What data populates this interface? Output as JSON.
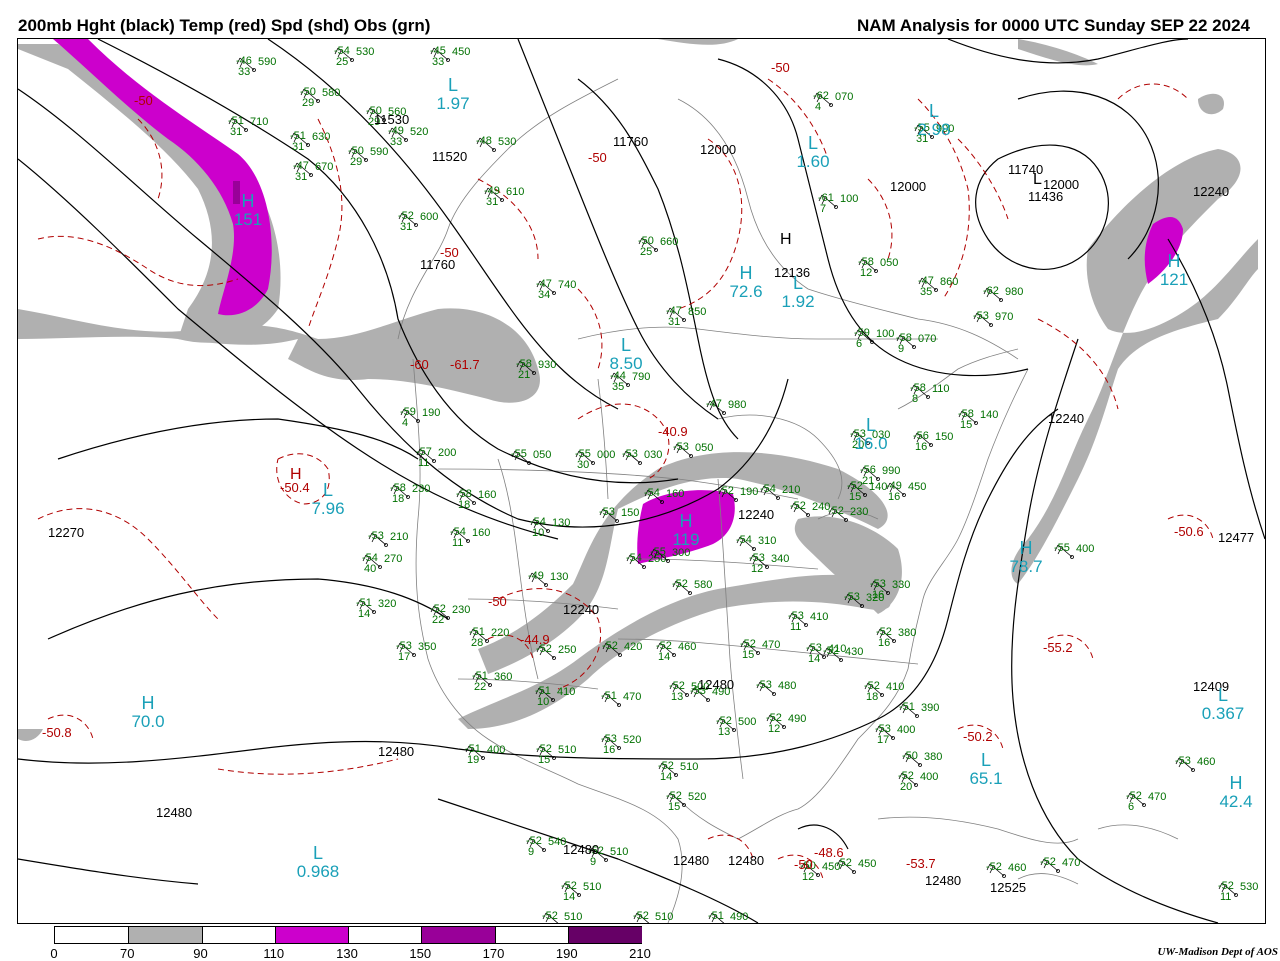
{
  "header": {
    "left_title": "200mb Hght (black) Temp (red) Spd (shd) Obs (grn)",
    "right_title": "NAM Analysis for 0000 UTC Sunday  SEP 22 2024"
  },
  "credit": "UW-Madison   Dept of AOS",
  "colors": {
    "height": "#000000",
    "temp": "#b00000",
    "speed_label": "#1aa0b8",
    "obs": "#007000",
    "geo": "#808080",
    "shade_70": "#b0b0b0",
    "shade_110": "#cc00cc",
    "shade_150": "#990099",
    "shade_190": "#660066"
  },
  "legend": {
    "ticks": [
      "0",
      "70",
      "90",
      "110",
      "130",
      "150",
      "170",
      "190",
      "210"
    ],
    "segment_colors": [
      "#ffffff",
      "#b0b0b0",
      "#ffffff",
      "#cc00cc",
      "#ffffff",
      "#990099",
      "#ffffff",
      "#660066"
    ]
  },
  "height_labels": [
    "11520",
    "11530",
    "11760",
    "11760",
    "12000",
    "12000",
    "12000",
    "12136",
    "11740",
    "11436",
    "12240",
    "12270",
    "12477",
    "12240",
    "12240",
    "12240",
    "12409",
    "12480",
    "12480",
    "12480",
    "12525",
    "12480",
    "12480",
    "12480",
    "12480"
  ],
  "temp_labels": [
    "-50",
    "-50",
    "-50",
    "-50",
    "-61.7",
    "-60",
    "-40.9",
    "-50.4",
    "-50",
    "-44.9",
    "-50.6",
    "-55.2",
    "-50.2",
    "-50.8",
    "-48.6",
    "-50",
    "-53.7"
  ],
  "speed_centers": [
    {
      "symbol": "L",
      "value": "1.97"
    },
    {
      "symbol": "L",
      "value": "2.98"
    },
    {
      "symbol": "L",
      "value": "1.60"
    },
    {
      "symbol": "H",
      "value": "121"
    },
    {
      "symbol": "H",
      "value": "151"
    },
    {
      "symbol": "L",
      "value": "8.50"
    },
    {
      "symbol": "H",
      "value": "72.6"
    },
    {
      "symbol": "L",
      "value": "1.92"
    },
    {
      "symbol": "L",
      "value": "7.96"
    },
    {
      "symbol": "H",
      "value": "119"
    },
    {
      "symbol": "H",
      "value": "78.7"
    },
    {
      "symbol": "H",
      "value": "70.0"
    },
    {
      "symbol": "L",
      "value": "0.367"
    },
    {
      "symbol": "H",
      "value": "42.4"
    },
    {
      "symbol": "L",
      "value": "65.1"
    },
    {
      "symbol": "L",
      "value": "0.968"
    },
    {
      "symbol": "L",
      "value": "16.0"
    }
  ],
  "pressure_centers": [
    {
      "symbol": "L",
      "label": "height"
    },
    {
      "symbol": "H",
      "label": "height"
    },
    {
      "symbol": "H",
      "label": "temp"
    }
  ],
  "observations": [
    {
      "t": "-46",
      "d": "33",
      "h": "590"
    },
    {
      "t": "-54",
      "d": "25",
      "h": "530"
    },
    {
      "t": "-45",
      "d": "33",
      "h": "450"
    },
    {
      "t": "-50",
      "d": "29",
      "h": "580"
    },
    {
      "t": "-50",
      "d": "29",
      "h": "560"
    },
    {
      "t": "-49",
      "d": "33",
      "h": "520"
    },
    {
      "t": "-51",
      "d": "31",
      "h": "710"
    },
    {
      "t": "-51",
      "d": "31",
      "h": "630"
    },
    {
      "t": "-50",
      "d": "29",
      "h": "590"
    },
    {
      "t": "-47",
      "d": "31",
      "h": "670"
    },
    {
      "t": "-48",
      "d": "",
      "h": "530"
    },
    {
      "t": "-49",
      "d": "31",
      "h": "610"
    },
    {
      "t": "-52",
      "d": "31",
      "h": "600"
    },
    {
      "t": "-50",
      "d": "25",
      "h": "660"
    },
    {
      "t": "-47",
      "d": "34",
      "h": "740"
    },
    {
      "t": "-47",
      "d": "31",
      "h": "850"
    },
    {
      "t": "-44",
      "d": "35",
      "h": "790"
    },
    {
      "t": "-47",
      "d": "",
      "h": "980"
    },
    {
      "t": "-62",
      "d": "4",
      "h": "070"
    },
    {
      "t": "-55",
      "d": "31",
      "h": "900"
    },
    {
      "t": "-61",
      "d": "7",
      "h": "100"
    },
    {
      "t": "-58",
      "d": "12",
      "h": "050"
    },
    {
      "t": "-47",
      "d": "35",
      "h": "860"
    },
    {
      "t": "-62",
      "d": "",
      "h": "980"
    },
    {
      "t": "-53",
      "d": "",
      "h": "970"
    },
    {
      "t": "-59",
      "d": "6",
      "h": "100"
    },
    {
      "t": "-58",
      "d": "9",
      "h": "070"
    },
    {
      "t": "-58",
      "d": "8",
      "h": "110"
    },
    {
      "t": "-58",
      "d": "15",
      "h": "140"
    },
    {
      "t": "-56",
      "d": "16",
      "h": "150"
    },
    {
      "t": "-53",
      "d": "20",
      "h": "030"
    },
    {
      "t": "-56",
      "d": "21",
      "h": "990"
    },
    {
      "t": "-58",
      "d": "21",
      "h": "930"
    },
    {
      "t": "-59",
      "d": "4",
      "h": "190"
    },
    {
      "t": "-57",
      "d": "11",
      "h": "200"
    },
    {
      "t": "-55",
      "d": "",
      "h": "050"
    },
    {
      "t": "-55",
      "d": "30",
      "h": "000"
    },
    {
      "t": "-53",
      "d": "",
      "h": "030"
    },
    {
      "t": "-53",
      "d": "",
      "h": "050"
    },
    {
      "t": "-58",
      "d": "18",
      "h": "230"
    },
    {
      "t": "-58",
      "d": "18",
      "h": "160"
    },
    {
      "t": "-53",
      "d": "",
      "h": "210"
    },
    {
      "t": "-54",
      "d": "11",
      "h": "160"
    },
    {
      "t": "-54",
      "d": "10",
      "h": "130"
    },
    {
      "t": "-53",
      "d": "",
      "h": "150"
    },
    {
      "t": "-54",
      "d": "",
      "h": "160"
    },
    {
      "t": "-52",
      "d": "",
      "h": "190"
    },
    {
      "t": "-52",
      "d": "15",
      "h": "140"
    },
    {
      "t": "-49",
      "d": "16",
      "h": "450"
    },
    {
      "t": "-54",
      "d": "",
      "h": "210"
    },
    {
      "t": "-52",
      "d": "",
      "h": "240"
    },
    {
      "t": "-52",
      "d": "",
      "h": "230"
    },
    {
      "t": "-54",
      "d": "40",
      "h": "270"
    },
    {
      "t": "-49",
      "d": "",
      "h": "130"
    },
    {
      "t": "-54",
      "d": "",
      "h": "310"
    },
    {
      "t": "-53",
      "d": "12",
      "h": "340"
    },
    {
      "t": "-55",
      "d": "",
      "h": "400"
    },
    {
      "t": "-54",
      "d": "",
      "h": "250"
    },
    {
      "t": "-55",
      "d": "",
      "h": "300"
    },
    {
      "t": "-51",
      "d": "14",
      "h": "320"
    },
    {
      "t": "-52",
      "d": "22",
      "h": "230"
    },
    {
      "t": "-51",
      "d": "28",
      "h": "220"
    },
    {
      "t": "-53",
      "d": "17",
      "h": "350"
    },
    {
      "t": "-52",
      "d": "",
      "h": "250"
    },
    {
      "t": "-52",
      "d": "",
      "h": "420"
    },
    {
      "t": "-52",
      "d": "14",
      "h": "460"
    },
    {
      "t": "-52",
      "d": "",
      "h": "580"
    },
    {
      "t": "-53",
      "d": "11",
      "h": "410"
    },
    {
      "t": "-53",
      "d": "",
      "h": "320"
    },
    {
      "t": "-53",
      "d": "16",
      "h": "330"
    },
    {
      "t": "-52",
      "d": "16",
      "h": "380"
    },
    {
      "t": "-52",
      "d": "15",
      "h": "470"
    },
    {
      "t": "-53",
      "d": "14",
      "h": "410"
    },
    {
      "t": "-52",
      "d": "",
      "h": "430"
    },
    {
      "t": "-51",
      "d": "22",
      "h": "360"
    },
    {
      "t": "-51",
      "d": "10",
      "h": "410"
    },
    {
      "t": "-51",
      "d": "",
      "h": "470"
    },
    {
      "t": "-52",
      "d": "13",
      "h": "500"
    },
    {
      "t": "-53",
      "d": "",
      "h": "490"
    },
    {
      "t": "-53",
      "d": "",
      "h": "480"
    },
    {
      "t": "-52",
      "d": "18",
      "h": "410"
    },
    {
      "t": "-51",
      "d": "",
      "h": "390"
    },
    {
      "t": "-52",
      "d": "13",
      "h": "500"
    },
    {
      "t": "-52",
      "d": "12",
      "h": "490"
    },
    {
      "t": "-53",
      "d": "17",
      "h": "400"
    },
    {
      "t": "-51",
      "d": "19",
      "h": "400"
    },
    {
      "t": "-52",
      "d": "15",
      "h": "510"
    },
    {
      "t": "-53",
      "d": "16",
      "h": "520"
    },
    {
      "t": "-52",
      "d": "14",
      "h": "510"
    },
    {
      "t": "-52",
      "d": "15",
      "h": "520"
    },
    {
      "t": "-50",
      "d": "",
      "h": "380"
    },
    {
      "t": "-52",
      "d": "20",
      "h": "400"
    },
    {
      "t": "-53",
      "d": "",
      "h": "460"
    },
    {
      "t": "-52",
      "d": "6",
      "h": "470"
    },
    {
      "t": "-52",
      "d": "9",
      "h": "540"
    },
    {
      "t": "-52",
      "d": "9",
      "h": "510"
    },
    {
      "t": "-52",
      "d": "14",
      "h": "510"
    },
    {
      "t": "-52",
      "d": "",
      "h": "510"
    },
    {
      "t": "-52",
      "d": "",
      "h": "510"
    },
    {
      "t": "-51",
      "d": "",
      "h": "490"
    },
    {
      "t": "-50",
      "d": "12",
      "h": "450"
    },
    {
      "t": "-52",
      "d": "",
      "h": "450"
    },
    {
      "t": "-52",
      "d": "",
      "h": "460"
    },
    {
      "t": "-52",
      "d": "",
      "h": "470"
    },
    {
      "t": "-52",
      "d": "11",
      "h": "530"
    }
  ]
}
